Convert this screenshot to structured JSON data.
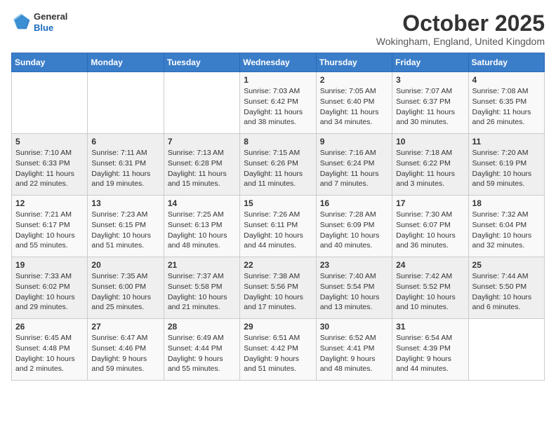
{
  "logo": {
    "general": "General",
    "blue": "Blue"
  },
  "title": "October 2025",
  "location": "Wokingham, England, United Kingdom",
  "days_of_week": [
    "Sunday",
    "Monday",
    "Tuesday",
    "Wednesday",
    "Thursday",
    "Friday",
    "Saturday"
  ],
  "weeks": [
    [
      {
        "day": "",
        "info": ""
      },
      {
        "day": "",
        "info": ""
      },
      {
        "day": "",
        "info": ""
      },
      {
        "day": "1",
        "info": "Sunrise: 7:03 AM\nSunset: 6:42 PM\nDaylight: 11 hours and 38 minutes."
      },
      {
        "day": "2",
        "info": "Sunrise: 7:05 AM\nSunset: 6:40 PM\nDaylight: 11 hours and 34 minutes."
      },
      {
        "day": "3",
        "info": "Sunrise: 7:07 AM\nSunset: 6:37 PM\nDaylight: 11 hours and 30 minutes."
      },
      {
        "day": "4",
        "info": "Sunrise: 7:08 AM\nSunset: 6:35 PM\nDaylight: 11 hours and 26 minutes."
      }
    ],
    [
      {
        "day": "5",
        "info": "Sunrise: 7:10 AM\nSunset: 6:33 PM\nDaylight: 11 hours and 22 minutes."
      },
      {
        "day": "6",
        "info": "Sunrise: 7:11 AM\nSunset: 6:31 PM\nDaylight: 11 hours and 19 minutes."
      },
      {
        "day": "7",
        "info": "Sunrise: 7:13 AM\nSunset: 6:28 PM\nDaylight: 11 hours and 15 minutes."
      },
      {
        "day": "8",
        "info": "Sunrise: 7:15 AM\nSunset: 6:26 PM\nDaylight: 11 hours and 11 minutes."
      },
      {
        "day": "9",
        "info": "Sunrise: 7:16 AM\nSunset: 6:24 PM\nDaylight: 11 hours and 7 minutes."
      },
      {
        "day": "10",
        "info": "Sunrise: 7:18 AM\nSunset: 6:22 PM\nDaylight: 11 hours and 3 minutes."
      },
      {
        "day": "11",
        "info": "Sunrise: 7:20 AM\nSunset: 6:19 PM\nDaylight: 10 hours and 59 minutes."
      }
    ],
    [
      {
        "day": "12",
        "info": "Sunrise: 7:21 AM\nSunset: 6:17 PM\nDaylight: 10 hours and 55 minutes."
      },
      {
        "day": "13",
        "info": "Sunrise: 7:23 AM\nSunset: 6:15 PM\nDaylight: 10 hours and 51 minutes."
      },
      {
        "day": "14",
        "info": "Sunrise: 7:25 AM\nSunset: 6:13 PM\nDaylight: 10 hours and 48 minutes."
      },
      {
        "day": "15",
        "info": "Sunrise: 7:26 AM\nSunset: 6:11 PM\nDaylight: 10 hours and 44 minutes."
      },
      {
        "day": "16",
        "info": "Sunrise: 7:28 AM\nSunset: 6:09 PM\nDaylight: 10 hours and 40 minutes."
      },
      {
        "day": "17",
        "info": "Sunrise: 7:30 AM\nSunset: 6:07 PM\nDaylight: 10 hours and 36 minutes."
      },
      {
        "day": "18",
        "info": "Sunrise: 7:32 AM\nSunset: 6:04 PM\nDaylight: 10 hours and 32 minutes."
      }
    ],
    [
      {
        "day": "19",
        "info": "Sunrise: 7:33 AM\nSunset: 6:02 PM\nDaylight: 10 hours and 29 minutes."
      },
      {
        "day": "20",
        "info": "Sunrise: 7:35 AM\nSunset: 6:00 PM\nDaylight: 10 hours and 25 minutes."
      },
      {
        "day": "21",
        "info": "Sunrise: 7:37 AM\nSunset: 5:58 PM\nDaylight: 10 hours and 21 minutes."
      },
      {
        "day": "22",
        "info": "Sunrise: 7:38 AM\nSunset: 5:56 PM\nDaylight: 10 hours and 17 minutes."
      },
      {
        "day": "23",
        "info": "Sunrise: 7:40 AM\nSunset: 5:54 PM\nDaylight: 10 hours and 13 minutes."
      },
      {
        "day": "24",
        "info": "Sunrise: 7:42 AM\nSunset: 5:52 PM\nDaylight: 10 hours and 10 minutes."
      },
      {
        "day": "25",
        "info": "Sunrise: 7:44 AM\nSunset: 5:50 PM\nDaylight: 10 hours and 6 minutes."
      }
    ],
    [
      {
        "day": "26",
        "info": "Sunrise: 6:45 AM\nSunset: 4:48 PM\nDaylight: 10 hours and 2 minutes."
      },
      {
        "day": "27",
        "info": "Sunrise: 6:47 AM\nSunset: 4:46 PM\nDaylight: 9 hours and 59 minutes."
      },
      {
        "day": "28",
        "info": "Sunrise: 6:49 AM\nSunset: 4:44 PM\nDaylight: 9 hours and 55 minutes."
      },
      {
        "day": "29",
        "info": "Sunrise: 6:51 AM\nSunset: 4:42 PM\nDaylight: 9 hours and 51 minutes."
      },
      {
        "day": "30",
        "info": "Sunrise: 6:52 AM\nSunset: 4:41 PM\nDaylight: 9 hours and 48 minutes."
      },
      {
        "day": "31",
        "info": "Sunrise: 6:54 AM\nSunset: 4:39 PM\nDaylight: 9 hours and 44 minutes."
      },
      {
        "day": "",
        "info": ""
      }
    ]
  ]
}
